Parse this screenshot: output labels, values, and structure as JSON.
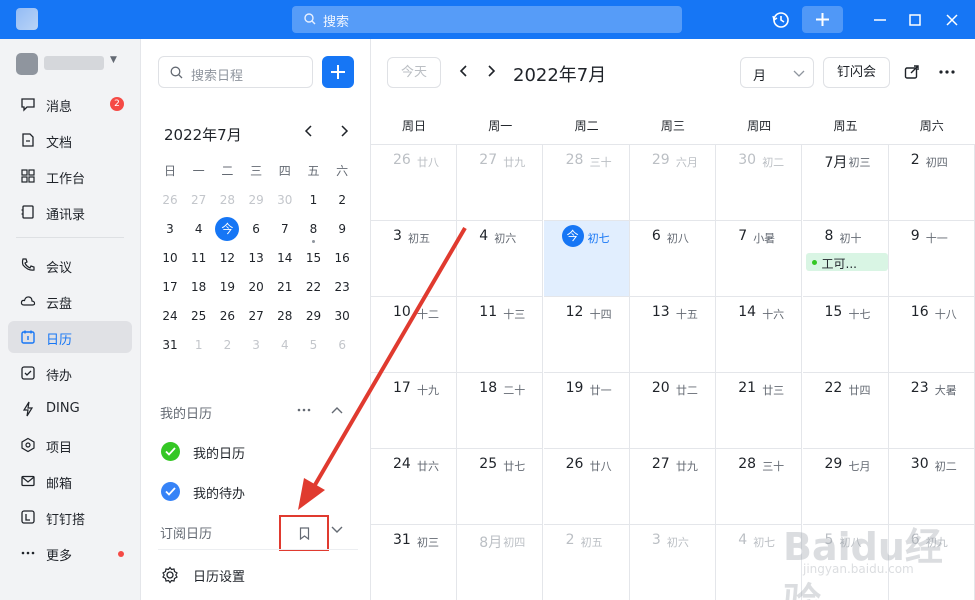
{
  "titlebar": {
    "search_placeholder": "搜索"
  },
  "nav": {
    "items": [
      {
        "label": "消息",
        "badge": "2"
      },
      {
        "label": "文档"
      },
      {
        "label": "工作台"
      },
      {
        "label": "通讯录"
      },
      {
        "label": "会议"
      },
      {
        "label": "云盘"
      },
      {
        "label": "日历"
      },
      {
        "label": "待办"
      },
      {
        "label": "DING"
      },
      {
        "label": "项目"
      },
      {
        "label": "邮箱"
      },
      {
        "label": "钉钉搭"
      },
      {
        "label": "更多"
      }
    ]
  },
  "side": {
    "search_placeholder": "搜索日程",
    "mini_title": "2022年7月",
    "weekdays": [
      "日",
      "一",
      "二",
      "三",
      "四",
      "五",
      "六"
    ],
    "days": [
      [
        "26",
        "27",
        "28",
        "29",
        "30",
        "1",
        "2"
      ],
      [
        "3",
        "4",
        "今",
        "6",
        "7",
        "8",
        "9"
      ],
      [
        "10",
        "11",
        "12",
        "13",
        "14",
        "15",
        "16"
      ],
      [
        "17",
        "18",
        "19",
        "20",
        "21",
        "22",
        "23"
      ],
      [
        "24",
        "25",
        "26",
        "27",
        "28",
        "29",
        "30"
      ],
      [
        "31",
        "1",
        "2",
        "3",
        "4",
        "5",
        "6"
      ]
    ],
    "my_calendars_title": "我的日历",
    "my_calendar": "我的日历",
    "my_todo": "我的待办",
    "subscribed_title": "订阅日历",
    "settings": "日历设置"
  },
  "main": {
    "today_label": "今天",
    "title": "2022年7月",
    "view": "月",
    "flash_meeting": "钉闪会",
    "weekdays": [
      "周日",
      "周一",
      "周二",
      "周三",
      "周四",
      "周五",
      "周六"
    ],
    "weeks": [
      [
        [
          "26",
          "廿八"
        ],
        [
          "27",
          "廿九"
        ],
        [
          "28",
          "三十"
        ],
        [
          "29",
          "六月"
        ],
        [
          "30",
          "初二"
        ],
        [
          "7月",
          "初三"
        ],
        [
          "2",
          "初四"
        ]
      ],
      [
        [
          "3",
          "初五"
        ],
        [
          "4",
          "初六"
        ],
        [
          "今",
          "初七"
        ],
        [
          "6",
          "初八"
        ],
        [
          "7",
          "小暑"
        ],
        [
          "8",
          "初十"
        ],
        [
          "9",
          "十一"
        ]
      ],
      [
        [
          "10",
          "十二"
        ],
        [
          "11",
          "十三"
        ],
        [
          "12",
          "十四"
        ],
        [
          "13",
          "十五"
        ],
        [
          "14",
          "十六"
        ],
        [
          "15",
          "十七"
        ],
        [
          "16",
          "十八"
        ]
      ],
      [
        [
          "17",
          "十九"
        ],
        [
          "18",
          "二十"
        ],
        [
          "19",
          "廿一"
        ],
        [
          "20",
          "廿二"
        ],
        [
          "21",
          "廿三"
        ],
        [
          "22",
          "廿四"
        ],
        [
          "23",
          "大暑"
        ]
      ],
      [
        [
          "24",
          "廿六"
        ],
        [
          "25",
          "廿七"
        ],
        [
          "26",
          "廿八"
        ],
        [
          "27",
          "廿九"
        ],
        [
          "28",
          "三十"
        ],
        [
          "29",
          "七月"
        ],
        [
          "30",
          "初二"
        ]
      ],
      [
        [
          "31",
          "初三"
        ],
        [
          "8月",
          "初四"
        ],
        [
          "2",
          "初五"
        ],
        [
          "3",
          "初六"
        ],
        [
          "4",
          "初七"
        ],
        [
          "5",
          "初八"
        ],
        [
          "6",
          "初九"
        ]
      ]
    ],
    "event_label": "工可..."
  },
  "watermark": {
    "brand": "Baidu经验",
    "url": "jingyan.baidu.com"
  },
  "colors": {
    "accent": "#1676f5",
    "annotation": "#e03a2f",
    "event_bg": "#d9f5e4"
  }
}
